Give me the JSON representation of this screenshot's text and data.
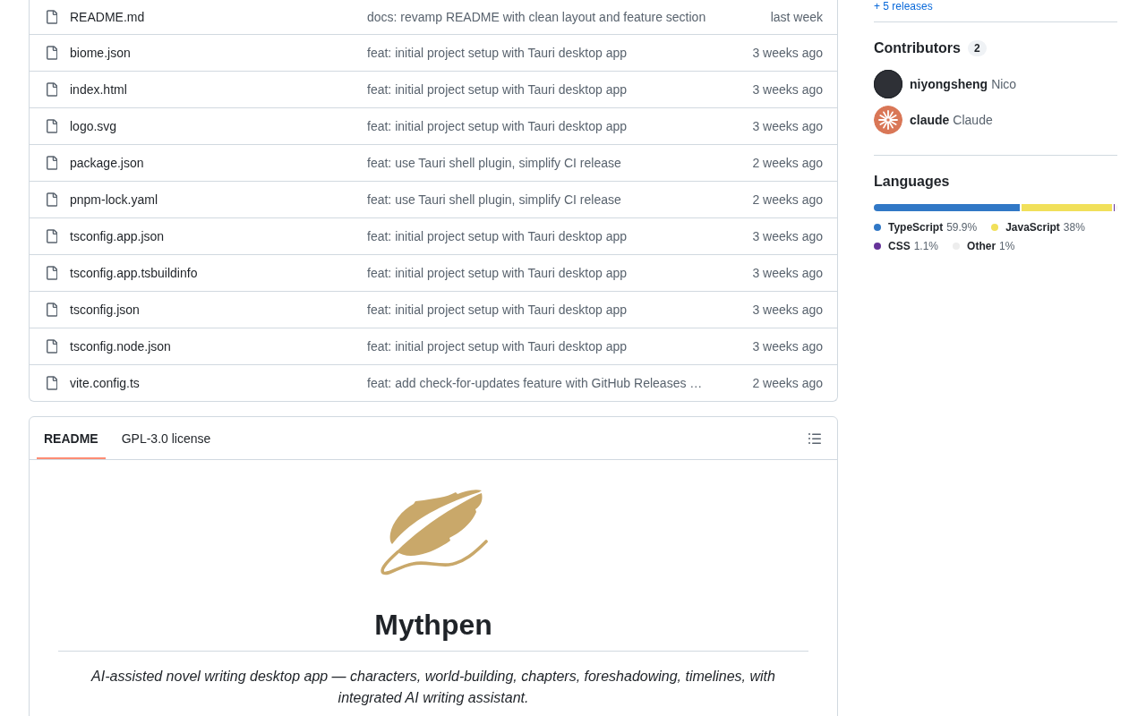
{
  "files": [
    {
      "name": "README.md",
      "message": "docs: revamp README with clean layout and feature section",
      "date": "last week"
    },
    {
      "name": "biome.json",
      "message": "feat: initial project setup with Tauri desktop app",
      "date": "3 weeks ago"
    },
    {
      "name": "index.html",
      "message": "feat: initial project setup with Tauri desktop app",
      "date": "3 weeks ago"
    },
    {
      "name": "logo.svg",
      "message": "feat: initial project setup with Tauri desktop app",
      "date": "3 weeks ago"
    },
    {
      "name": "package.json",
      "message": "feat: use Tauri shell plugin, simplify CI release",
      "date": "2 weeks ago"
    },
    {
      "name": "pnpm-lock.yaml",
      "message": "feat: use Tauri shell plugin, simplify CI release",
      "date": "2 weeks ago"
    },
    {
      "name": "tsconfig.app.json",
      "message": "feat: initial project setup with Tauri desktop app",
      "date": "3 weeks ago"
    },
    {
      "name": "tsconfig.app.tsbuildinfo",
      "message": "feat: initial project setup with Tauri desktop app",
      "date": "3 weeks ago"
    },
    {
      "name": "tsconfig.json",
      "message": "feat: initial project setup with Tauri desktop app",
      "date": "3 weeks ago"
    },
    {
      "name": "tsconfig.node.json",
      "message": "feat: initial project setup with Tauri desktop app",
      "date": "3 weeks ago"
    },
    {
      "name": "vite.config.ts",
      "message": "feat: add check-for-updates feature with GitHub Releases …",
      "date": "2 weeks ago"
    }
  ],
  "readme": {
    "tabs": [
      {
        "label": "README",
        "selected": true
      },
      {
        "label": "GPL-3.0 license",
        "selected": false
      }
    ],
    "title": "Mythpen",
    "description": "AI-assisted novel writing desktop app — characters, world-building, chapters, foreshadowing, timelines, with integrated AI writing assistant."
  },
  "sidebar": {
    "releases_link": "+ 5 releases",
    "contributors": {
      "title": "Contributors",
      "count": "2",
      "people": [
        {
          "kind": "photo",
          "login": "niyongsheng",
          "name": "Nico"
        },
        {
          "kind": "logo",
          "login": "claude",
          "name": "Claude"
        }
      ]
    },
    "languages": {
      "title": "Languages",
      "items": [
        {
          "name": "TypeScript",
          "percent": "59.9%",
          "level": 0.599,
          "color": "#3178c6"
        },
        {
          "name": "JavaScript",
          "percent": "38%",
          "level": 0.38,
          "color": "#f1e05a"
        },
        {
          "name": "CSS",
          "percent": "1.1%",
          "level": 0.011,
          "color": "#663399"
        },
        {
          "name": "Other",
          "percent": "1%",
          "level": 0.01,
          "color": "#ededed"
        }
      ]
    }
  }
}
